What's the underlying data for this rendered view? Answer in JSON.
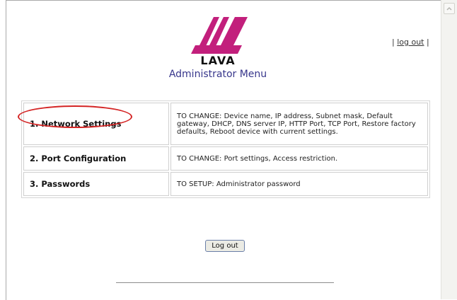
{
  "header": {
    "logo_text": "LAVA",
    "title": "Administrator Menu",
    "logout_link": {
      "prefix": "|",
      "label": "log out",
      "suffix": "|"
    }
  },
  "menu": {
    "rows": [
      {
        "label": "1. Network Settings",
        "description": "TO CHANGE: Device name, IP address, Subnet mask, Default gateway, DHCP, DNS server IP, HTTP Port, TCP Port, Restore factory defaults, Reboot device with current settings.",
        "highlighted": true
      },
      {
        "label": "2. Port Configuration",
        "description": "TO CHANGE: Port settings, Access restriction."
      },
      {
        "label": "3. Passwords",
        "description": "TO SETUP: Administrator password"
      }
    ]
  },
  "footer": {
    "logout_button": "Log out"
  },
  "colors": {
    "logo_magenta": "#c21f7c",
    "title_blue": "#37368b",
    "highlight_red": "#d42424"
  }
}
